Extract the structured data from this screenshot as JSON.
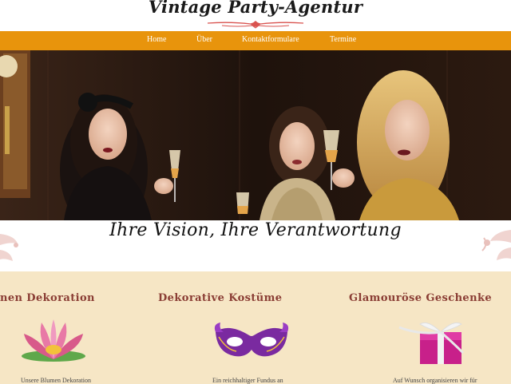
{
  "site": {
    "logo_text": "Vintage Party-Agentur"
  },
  "nav": {
    "items": [
      {
        "label": "Home"
      },
      {
        "label": "Über"
      },
      {
        "label": "Kontaktformulare"
      },
      {
        "label": "Termine"
      }
    ]
  },
  "hero": {
    "tagline": "Ihre Vision,  Ihre Verantwortung"
  },
  "features": [
    {
      "title": "nen Dekoration",
      "text": "Unsere Blumen Dekoration",
      "icon": "lotus-flower-icon"
    },
    {
      "title": "Dekorative Kostüme",
      "text": "Ein reichhaltiger Fundus an",
      "icon": "masquerade-mask-icon"
    },
    {
      "title": "Glamouröse Geschenke",
      "text": "Auf Wunsch organisieren wir für",
      "icon": "gift-box-icon"
    }
  ],
  "colors": {
    "nav_bg": "#e8940c",
    "features_bg": "#f6e6c5",
    "feature_title": "#8a3d34"
  }
}
